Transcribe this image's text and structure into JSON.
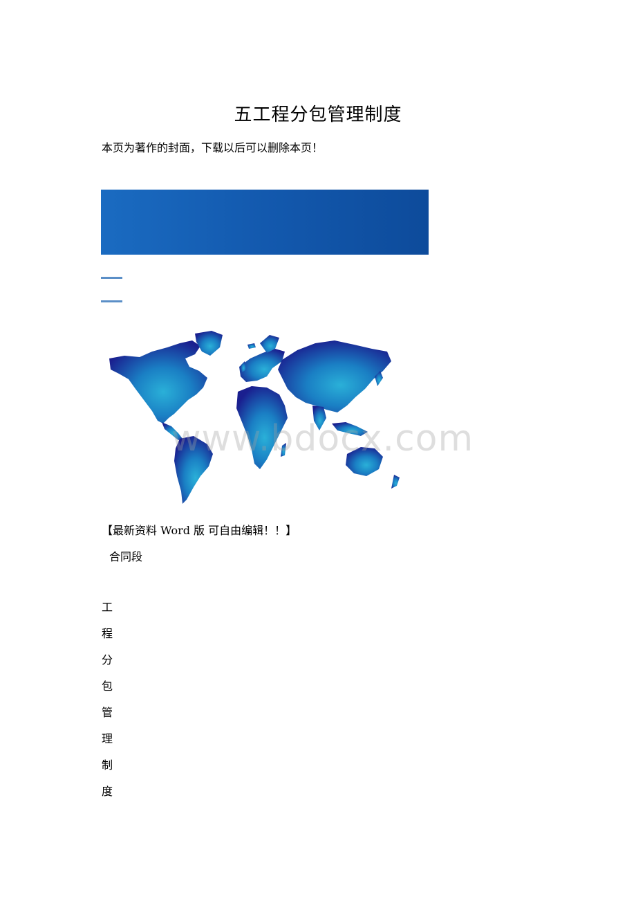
{
  "document": {
    "title": "五工程分包管理制度",
    "cover_note": "本页为著作的封面，下载以后可以删除本页！",
    "edit_note": "【最新资料 Word 版 可自由编辑！！】",
    "section_label": "合同段",
    "vertical_title_chars": [
      "工",
      "程",
      "分",
      "包",
      "管",
      "理",
      "制",
      "度"
    ]
  },
  "watermark": {
    "text": "www.bdocx.com"
  },
  "colors": {
    "banner_start": "#1a6bc1",
    "banner_end": "#0d4b9b",
    "accent_line": "#5b8fc7",
    "map_dark": "#1a1f8f",
    "map_light": "#2ab0d8"
  }
}
